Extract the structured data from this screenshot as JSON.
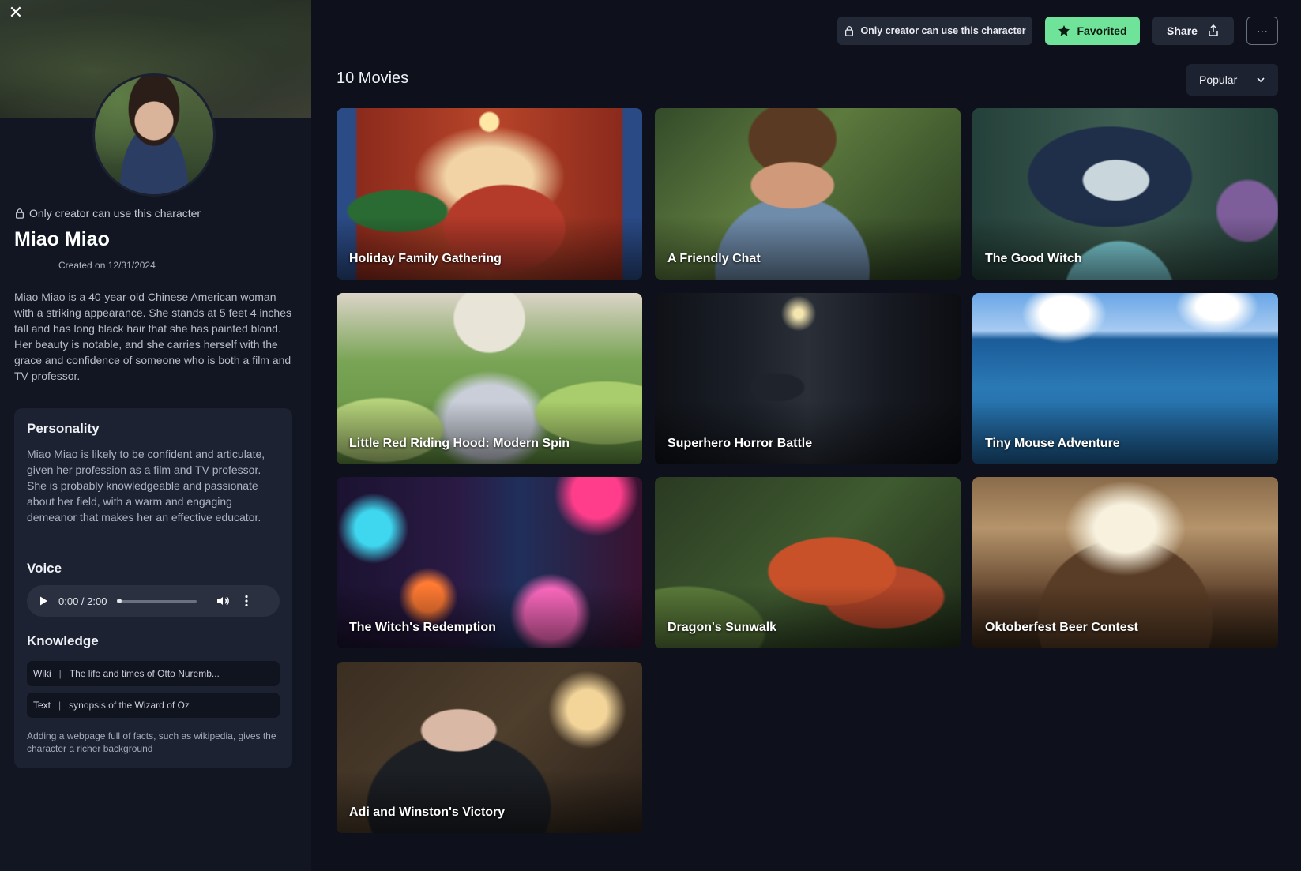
{
  "sidebar": {
    "close_label": "✕",
    "access_text": "Only creator can use this character",
    "name": "Miao Miao",
    "created": "Created on 12/31/2024",
    "description": "Miao Miao is a 40-year-old Chinese American woman with a striking appearance. She stands at 5 feet 4 inches tall and has long black hair that she has painted blond. Her beauty is notable, and she carries herself with the grace and confidence of someone who is both a film and TV professor.",
    "personality": {
      "title": "Personality",
      "text": "Miao Miao is likely to be confident and articulate, given her profession as a film and TV professor. She is probably knowledgeable and passionate about her field, with a warm and engaging demeanor that makes her an effective educator."
    },
    "voice": {
      "title": "Voice",
      "time": "0:00 / 2:00",
      "progress": 0
    },
    "knowledge": {
      "title": "Knowledge",
      "items": [
        {
          "type": "Wiki",
          "value": "The life and times of Otto Nuremb..."
        },
        {
          "type": "Text",
          "value": "synopsis of the Wizard of Oz"
        }
      ],
      "hint": "Adding a webpage full of facts, such as wikipedia, gives the character a richer background"
    }
  },
  "topbar": {
    "private_label": "Only creator can use this character",
    "favorited_label": "Favorited",
    "share_label": "Share",
    "more_label": "···"
  },
  "movies": {
    "heading": "10 Movies",
    "sort": "Popular",
    "items": [
      {
        "title": "Holiday Family Gathering",
        "art": "holiday"
      },
      {
        "title": "A Friendly Chat",
        "art": "chat"
      },
      {
        "title": "The Good Witch",
        "art": "witch"
      },
      {
        "title": "Little Red Riding Hood: Modern Spin",
        "art": "redhood"
      },
      {
        "title": "Superhero Horror Battle",
        "art": "horror"
      },
      {
        "title": "Tiny Mouse Adventure",
        "art": "sea"
      },
      {
        "title": "The Witch's Redemption",
        "art": "neon"
      },
      {
        "title": "Dragon's Sunwalk",
        "art": "dragon"
      },
      {
        "title": "Oktoberfest Beer Contest",
        "art": "beer"
      },
      {
        "title": "Adi and Winston's Victory",
        "art": "winston"
      }
    ]
  },
  "colors": {
    "background": "#0e111b",
    "sidebar": "#121623",
    "card": "#1c2232",
    "favorite_accent": "#6fe39a"
  }
}
